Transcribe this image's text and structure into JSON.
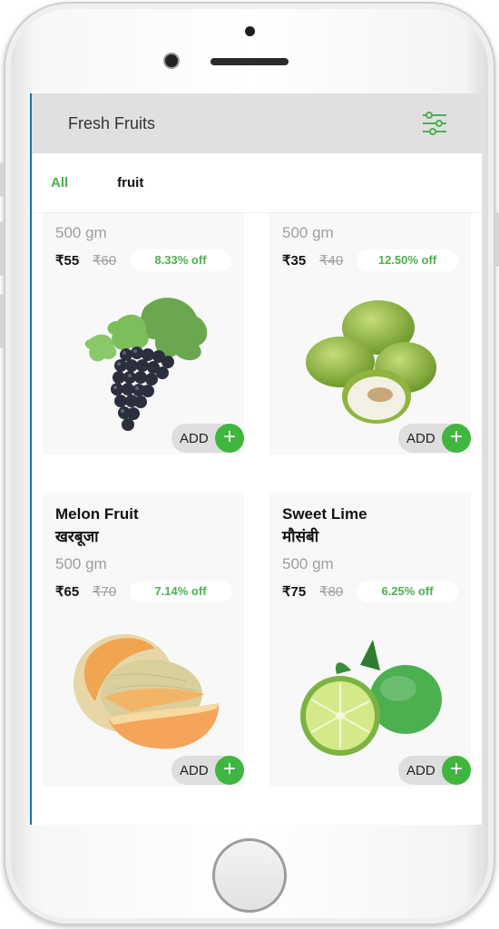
{
  "appbar": {
    "title": "Fresh Fruits",
    "filter_icon": "sliders-icon"
  },
  "tabs": [
    {
      "label": "All",
      "active": true
    },
    {
      "label": "fruit",
      "active": false
    }
  ],
  "accent": "#4caf50",
  "products": [
    {
      "name": "",
      "hindi": "",
      "qty": "500 gm",
      "price": "₹55",
      "mrp": "₹60",
      "off": "8.33% off",
      "add": "ADD",
      "image": "grapes"
    },
    {
      "name": "",
      "hindi": "",
      "qty": "500 gm",
      "price": "₹35",
      "mrp": "₹40",
      "off": "12.50% off",
      "add": "ADD",
      "image": "ber-jujube"
    },
    {
      "name": "Melon Fruit",
      "hindi": "खरबूजा",
      "qty": "500 gm",
      "price": "₹65",
      "mrp": "₹70",
      "off": "7.14% off",
      "add": "ADD",
      "image": "melon"
    },
    {
      "name": "Sweet Lime",
      "hindi": "मौसंबी",
      "qty": "500 gm",
      "price": "₹75",
      "mrp": "₹80",
      "off": "6.25% off",
      "add": "ADD",
      "image": "sweet-lime"
    }
  ]
}
